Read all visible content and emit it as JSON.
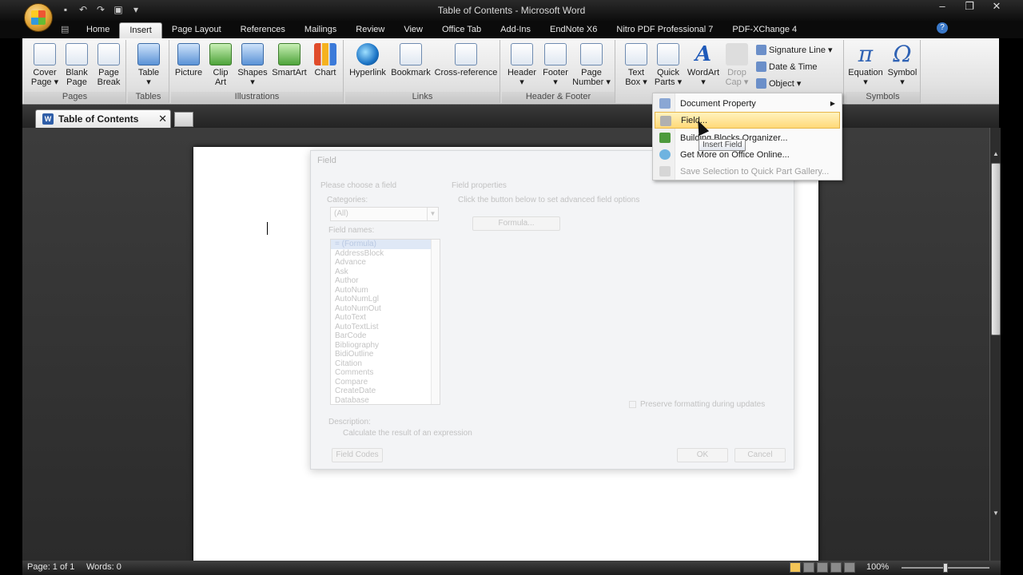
{
  "window": {
    "title": "Table of Contents - Microsoft Word",
    "controls": [
      "–",
      "❐",
      "✕"
    ]
  },
  "ribbon_tabs": [
    "Home",
    "Insert",
    "Page Layout",
    "References",
    "Mailings",
    "Review",
    "View",
    "Office Tab",
    "Add-Ins",
    "EndNote X6",
    "Nitro PDF Professional 7",
    "PDF-XChange 4"
  ],
  "active_tab": "Insert",
  "groups": {
    "pages": {
      "label": "Pages",
      "cover": "Cover\nPage ▾",
      "blank": "Blank\nPage",
      "break": "Page\nBreak"
    },
    "tables": {
      "label": "Tables",
      "table": "Table\n▾"
    },
    "illustrations": {
      "label": "Illustrations",
      "picture": "Picture",
      "clipart": "Clip\nArt",
      "shapes": "Shapes\n▾",
      "smartart": "SmartArt",
      "chart": "Chart"
    },
    "links": {
      "label": "Links",
      "hyperlink": "Hyperlink",
      "bookmark": "Bookmark",
      "crossref": "Cross-reference"
    },
    "headerfooter": {
      "label": "Header & Footer",
      "header": "Header\n▾",
      "footer": "Footer\n▾",
      "pagenumber": "Page\nNumber ▾"
    },
    "text": {
      "textbox": "Text\nBox ▾",
      "quickparts": "Quick\nParts ▾",
      "wordart": "WordArt\n▾",
      "dropcap": "Drop\nCap ▾",
      "signature": "Signature Line ▾",
      "datetime": "Date & Time",
      "object": "Object ▾"
    },
    "symbols": {
      "label": "Symbols",
      "equation": "Equation\n▾",
      "symbol": "Symbol\n▾"
    }
  },
  "document_tab": {
    "label": "Table of Contents",
    "close": "✕"
  },
  "quick_parts_menu": {
    "items": [
      "Document Property",
      "Field...",
      "Building Blocks Organizer...",
      "Get More on Office Online...",
      "Save Selection to Quick Part Gallery..."
    ],
    "highlighted": "Field...",
    "tooltip": "Insert Field"
  },
  "field_dialog": {
    "title": "Field",
    "choose": "Please choose a field",
    "categories_label": "Categories:",
    "category_value": "(All)",
    "field_names_label": "Field names:",
    "field_names": [
      "= (Formula)",
      "AddressBlock",
      "Advance",
      "Ask",
      "Author",
      "AutoNum",
      "AutoNumLgl",
      "AutoNumOut",
      "AutoText",
      "AutoTextList",
      "BarCode",
      "Bibliography",
      "BidiOutline",
      "Citation",
      "Comments",
      "Compare",
      "CreateDate",
      "Database"
    ],
    "properties_label": "Field properties",
    "properties_hint": "Click the button below to set advanced field options",
    "formula_button": "Formula...",
    "preserve": "Preserve formatting during updates",
    "description_label": "Description:",
    "description": "Calculate the result of an expression",
    "field_codes": "Field Codes",
    "ok": "OK",
    "cancel": "Cancel"
  },
  "status": {
    "page": "Page: 1 of 1",
    "words": "Words: 0",
    "zoom": "100%"
  }
}
